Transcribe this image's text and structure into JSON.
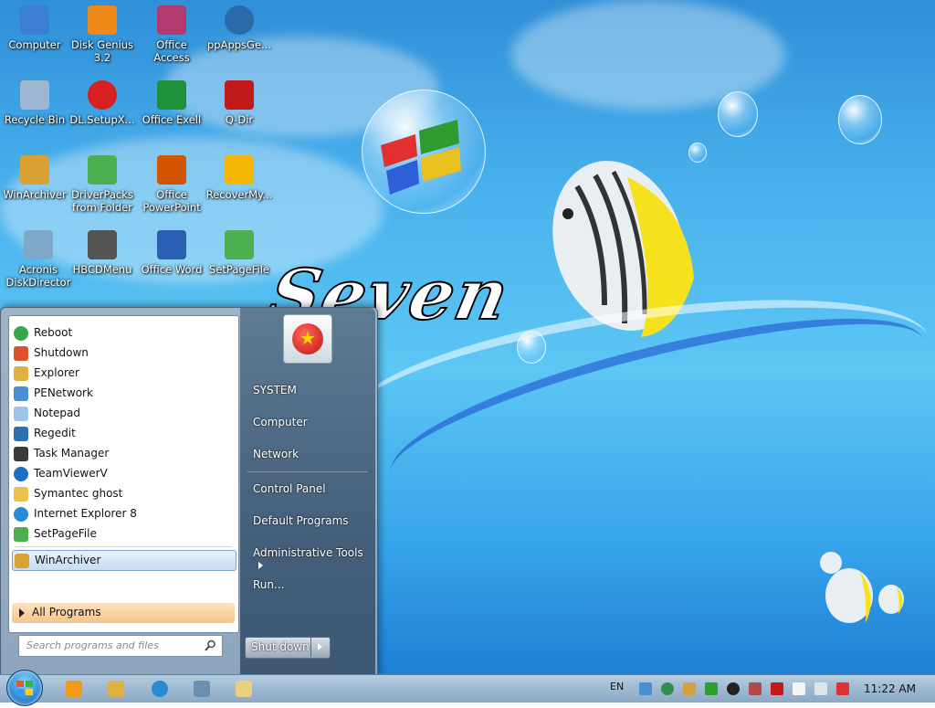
{
  "desktop": {
    "wallpaper_text": "Seven",
    "icons": [
      {
        "label": "Computer",
        "color": "#3b7fd4"
      },
      {
        "label": "Disk Genius 3.2",
        "color": "#ef8a1a"
      },
      {
        "label": "Office Access",
        "color": "#b23a6e"
      },
      {
        "label": "ppAppsGe...",
        "color": "#2a6aa8"
      },
      {
        "label": "Recycle Bin",
        "color": "#9cb6d2"
      },
      {
        "label": "DL.SetupX...",
        "color": "#d92020"
      },
      {
        "label": "Office Exell",
        "color": "#1e8f3a"
      },
      {
        "label": "Q-Dir",
        "color": "#c21a1a"
      },
      {
        "label": "WinArchiver",
        "color": "#d9a032"
      },
      {
        "label": "DriverPacks from Folder",
        "color": "#4caf50"
      },
      {
        "label": "Office PowerPoint",
        "color": "#d35400"
      },
      {
        "label": "RecoverMy...",
        "color": "#f2b705"
      },
      {
        "label": "Acronis DiskDirector",
        "color": "#7fa7c8"
      },
      {
        "label": "HBCDMenu",
        "color": "#555555"
      },
      {
        "label": "Office Word",
        "color": "#2b5fb4"
      },
      {
        "label": "SetPageFile",
        "color": "#4caf50"
      }
    ]
  },
  "start_menu": {
    "programs": [
      {
        "label": "Reboot",
        "color": "#37a84a"
      },
      {
        "label": "Shutdown",
        "color": "#d9532c"
      },
      {
        "label": "Explorer",
        "color": "#e0b040"
      },
      {
        "label": "PENetwork",
        "color": "#4a8fd0"
      },
      {
        "label": "Notepad",
        "color": "#9fc4e8"
      },
      {
        "label": "Regedit",
        "color": "#2f6fb0"
      },
      {
        "label": "Task Manager",
        "color": "#3a3a3a"
      },
      {
        "label": "TeamViewerV",
        "color": "#1c6fc4"
      },
      {
        "label": "Symantec ghost",
        "color": "#e8c24a"
      },
      {
        "label": "Internet Explorer 8",
        "color": "#2a8ad6"
      },
      {
        "label": "SetPageFile",
        "color": "#4caf50"
      }
    ],
    "selected_program": {
      "label": "WinArchiver",
      "color": "#d9a032"
    },
    "all_programs_label": "All Programs",
    "search_placeholder": "Search programs and files",
    "right_items": {
      "system": "SYSTEM",
      "computer": "Computer",
      "network": "Network",
      "control_panel": "Control Panel",
      "default_programs": "Default Programs",
      "admin_tools": "Administrative Tools",
      "run": "Run..."
    },
    "shutdown_label": "Shut down"
  },
  "taskbar": {
    "language": "EN",
    "clock": "11:22 AM",
    "pinned": [
      "media-player-icon",
      "explorer-folder-icon",
      "internet-explorer-icon",
      "network-icon",
      "paint-icon"
    ]
  }
}
